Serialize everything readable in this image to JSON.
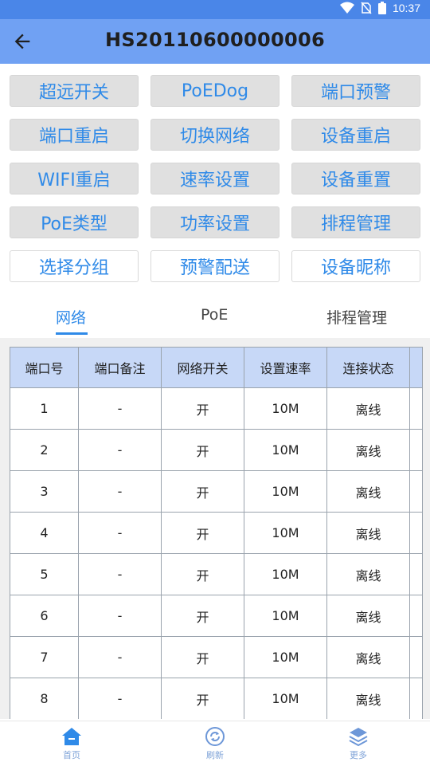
{
  "status": {
    "time": "10:37",
    "icons": [
      "wifi-icon",
      "no-sim-icon",
      "battery-icon"
    ]
  },
  "header": {
    "title": "HS20110600000006",
    "back_icon": "back-arrow-icon"
  },
  "buttons": [
    "超远开关",
    "PoEDog",
    "端口预警",
    "端口重启",
    "切换网络",
    "设备重启",
    "WIFI重启",
    "速率设置",
    "设备重置",
    "PoE类型",
    "功率设置",
    "排程管理",
    "选择分组",
    "预警配送",
    "设备昵称"
  ],
  "tabs": [
    {
      "label": "网络",
      "active": true
    },
    {
      "label": "PoE"
    },
    {
      "label": "排程管理"
    }
  ],
  "table": {
    "headers": [
      "端口号",
      "端口备注",
      "网络开关",
      "设置速率",
      "连接状态"
    ],
    "rows": [
      [
        "1",
        "-",
        "开",
        "10M",
        "离线"
      ],
      [
        "2",
        "-",
        "开",
        "10M",
        "离线"
      ],
      [
        "3",
        "-",
        "开",
        "10M",
        "离线"
      ],
      [
        "4",
        "-",
        "开",
        "10M",
        "离线"
      ],
      [
        "5",
        "-",
        "开",
        "10M",
        "离线"
      ],
      [
        "6",
        "-",
        "开",
        "10M",
        "离线"
      ],
      [
        "7",
        "-",
        "开",
        "10M",
        "离线"
      ],
      [
        "8",
        "-",
        "开",
        "10M",
        "离线"
      ]
    ]
  },
  "bottom_nav": [
    {
      "label": "首页",
      "icon": "home-icon"
    },
    {
      "label": "刷新",
      "icon": "refresh-icon"
    },
    {
      "label": "更多",
      "icon": "layers-icon"
    }
  ],
  "colors": {
    "status_bar": "#4a86e8",
    "app_bar": "#70a1f3",
    "accent": "#2f8ae8",
    "header_cell": "#c7d8f7"
  }
}
